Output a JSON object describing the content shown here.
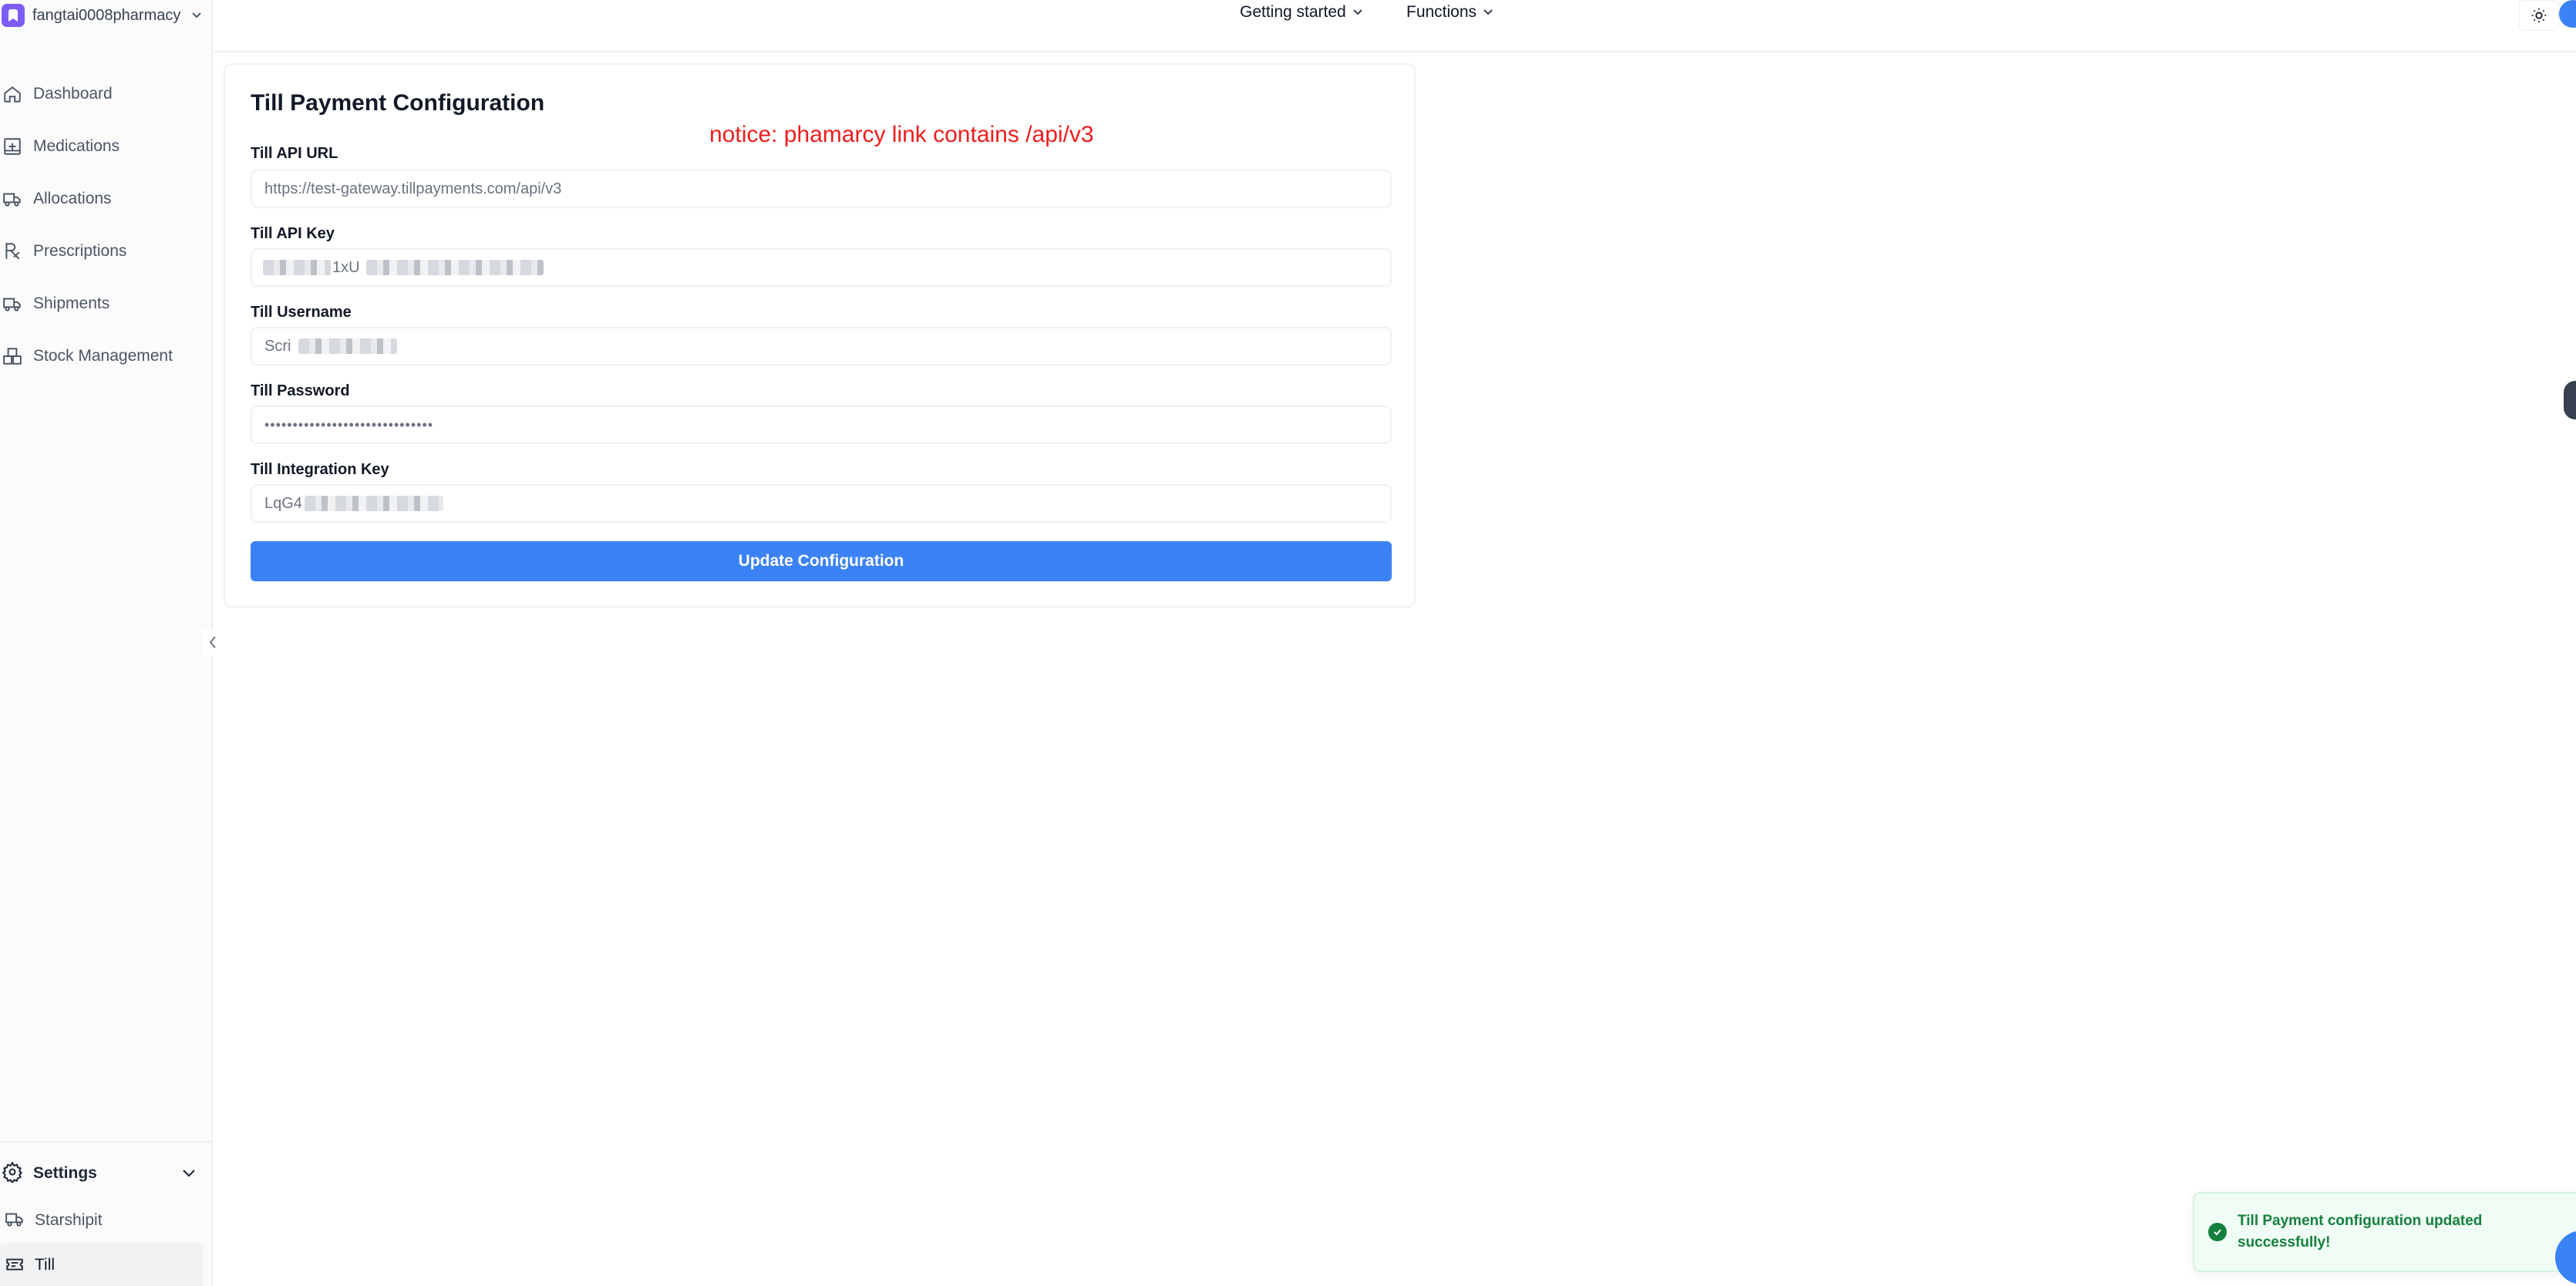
{
  "org": {
    "name": "fangtai0008pharmacy"
  },
  "sidebar": {
    "items": [
      {
        "label": "Dashboard",
        "icon": "home-icon"
      },
      {
        "label": "Medications",
        "icon": "medical-box-icon"
      },
      {
        "label": "Allocations",
        "icon": "truck-icon"
      },
      {
        "label": "Prescriptions",
        "icon": "rx-icon"
      },
      {
        "label": "Shipments",
        "icon": "truck-icon"
      },
      {
        "label": "Stock Management",
        "icon": "boxes-icon"
      }
    ],
    "settings": {
      "label": "Settings",
      "items": [
        {
          "label": "Starshipit",
          "icon": "truck-icon"
        },
        {
          "label": "Till",
          "icon": "ticket-icon"
        }
      ]
    }
  },
  "header": {
    "menus": [
      "Getting started",
      "Functions"
    ]
  },
  "card": {
    "title": "Till Payment Configuration",
    "notice": "notice: phamarcy link contains /api/v3",
    "fields": [
      {
        "label": "Till API URL",
        "value": "https://test-gateway.tillpayments.com/api/v3"
      },
      {
        "label": "Till API Key",
        "value": "1xU"
      },
      {
        "label": "Till Username",
        "value": "Scri"
      },
      {
        "label": "Till Password",
        "value": "••••••••••••••••••••••••••••••"
      },
      {
        "label": "Till Integration Key",
        "value": "LqG4"
      }
    ],
    "button": "Update Configuration"
  },
  "toast": {
    "message": "Till Payment configuration updated successfully!"
  },
  "colors": {
    "accent": "#3b82f6",
    "notice": "#ef1c1c",
    "success": "#15803d",
    "logo": "#7c5cf5"
  }
}
